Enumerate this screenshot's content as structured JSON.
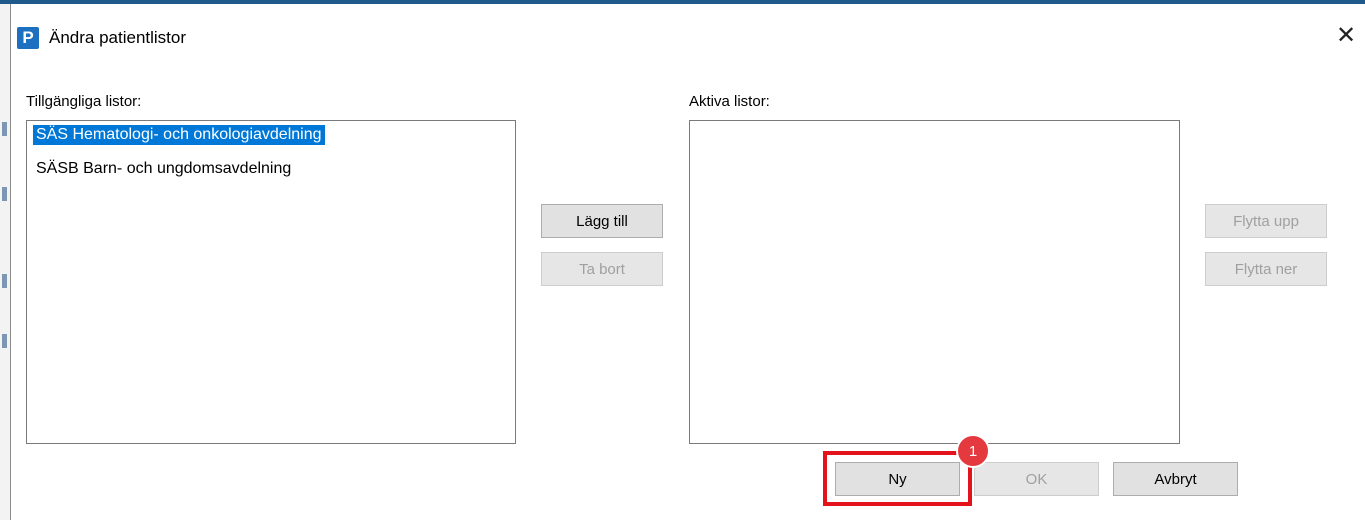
{
  "window": {
    "app_icon_letter": "P",
    "title": "Ändra patientlistor",
    "close_glyph": "✕"
  },
  "available": {
    "label": "Tillgängliga listor:",
    "items": [
      {
        "label": "SÄS Hematologi- och onkologiavdelning",
        "selected": true
      },
      {
        "label": "SÄSB Barn- och ungdomsavdelning",
        "selected": false
      }
    ]
  },
  "active": {
    "label": "Aktiva listor:",
    "items": []
  },
  "buttons": {
    "add": "Lägg till",
    "remove": "Ta bort",
    "move_up": "Flytta upp",
    "move_down": "Flytta ner",
    "new": "Ny",
    "ok": "OK",
    "cancel": "Avbryt"
  },
  "annotation": {
    "badge_number": "1",
    "color": "#e4121b"
  },
  "colors": {
    "selection": "#0078d7",
    "app_icon": "#1d6fbf",
    "title_border": "#1f5a8a"
  }
}
